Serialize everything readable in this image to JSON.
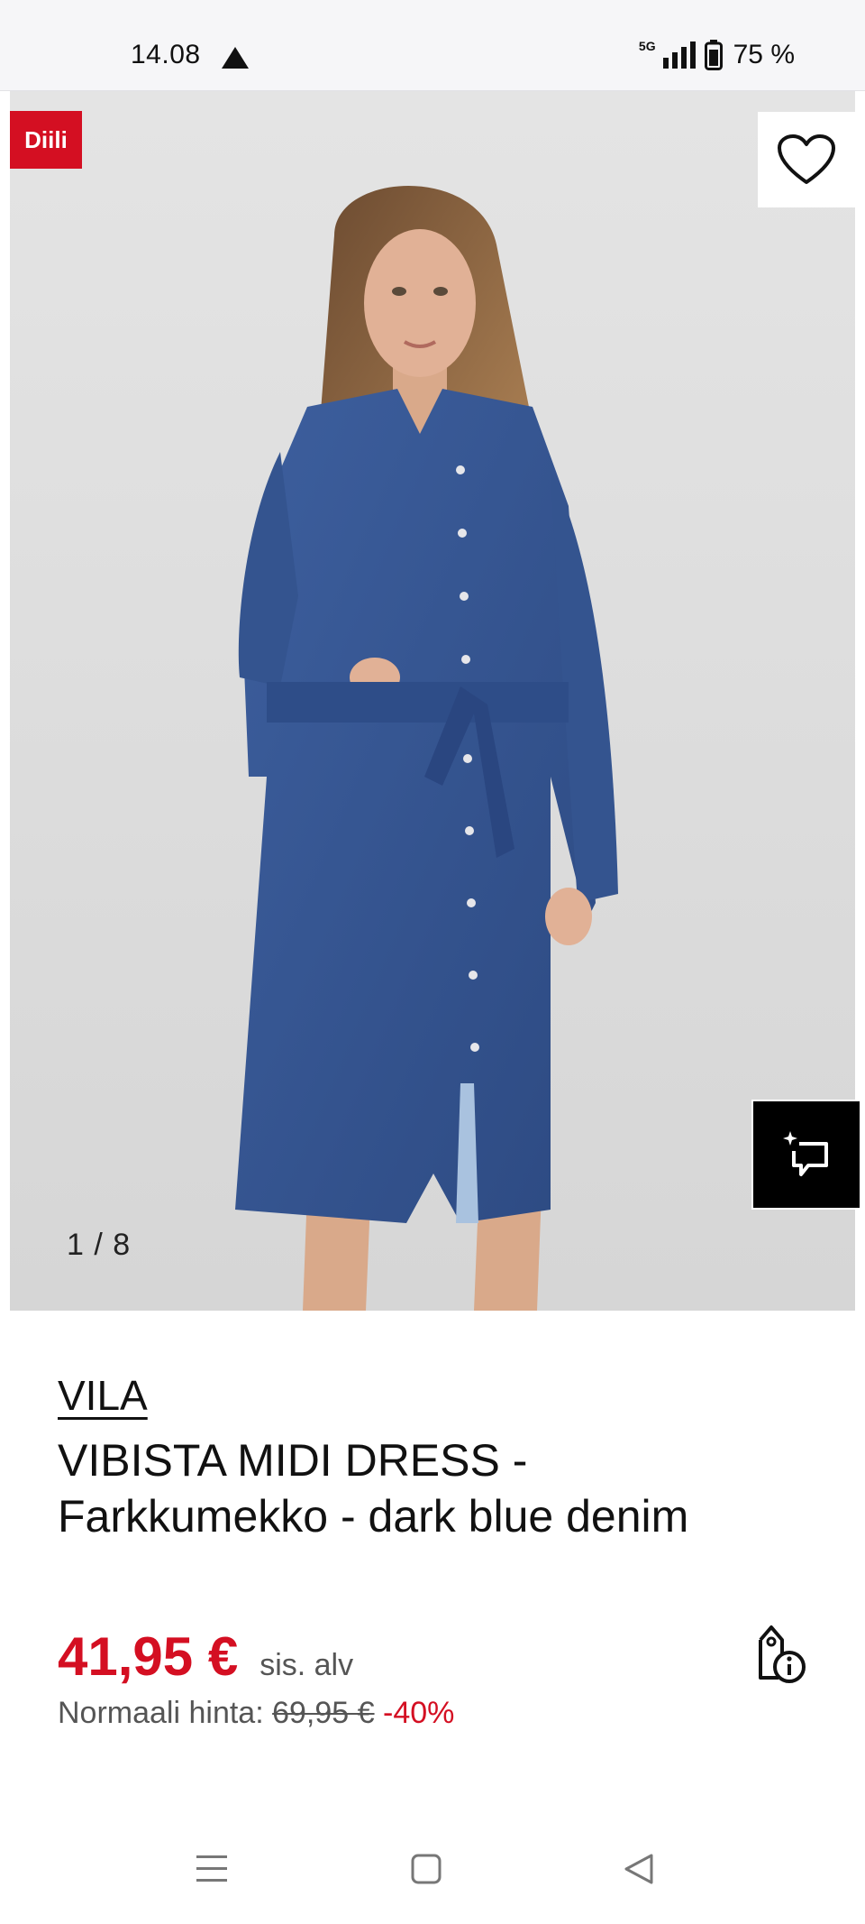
{
  "status_bar": {
    "time": "14.08",
    "network": "5G",
    "battery": "75 %"
  },
  "product_image": {
    "badge": "Diili",
    "counter": "1 / 8",
    "alt": "VIBISTA MIDI DRESS - Farkkumekko - dark blue denim"
  },
  "product": {
    "brand": "VILA",
    "name": "VIBISTA MIDI DRESS - Farkkumekko - dark blue denim",
    "price": "41,95 €",
    "vat_note": "sis. alv",
    "original_label": "Normaali hinta:",
    "original_price": "69,95 €",
    "discount": "-40%"
  },
  "colors": {
    "accent": "#d40f22",
    "denim": "#34548f"
  }
}
